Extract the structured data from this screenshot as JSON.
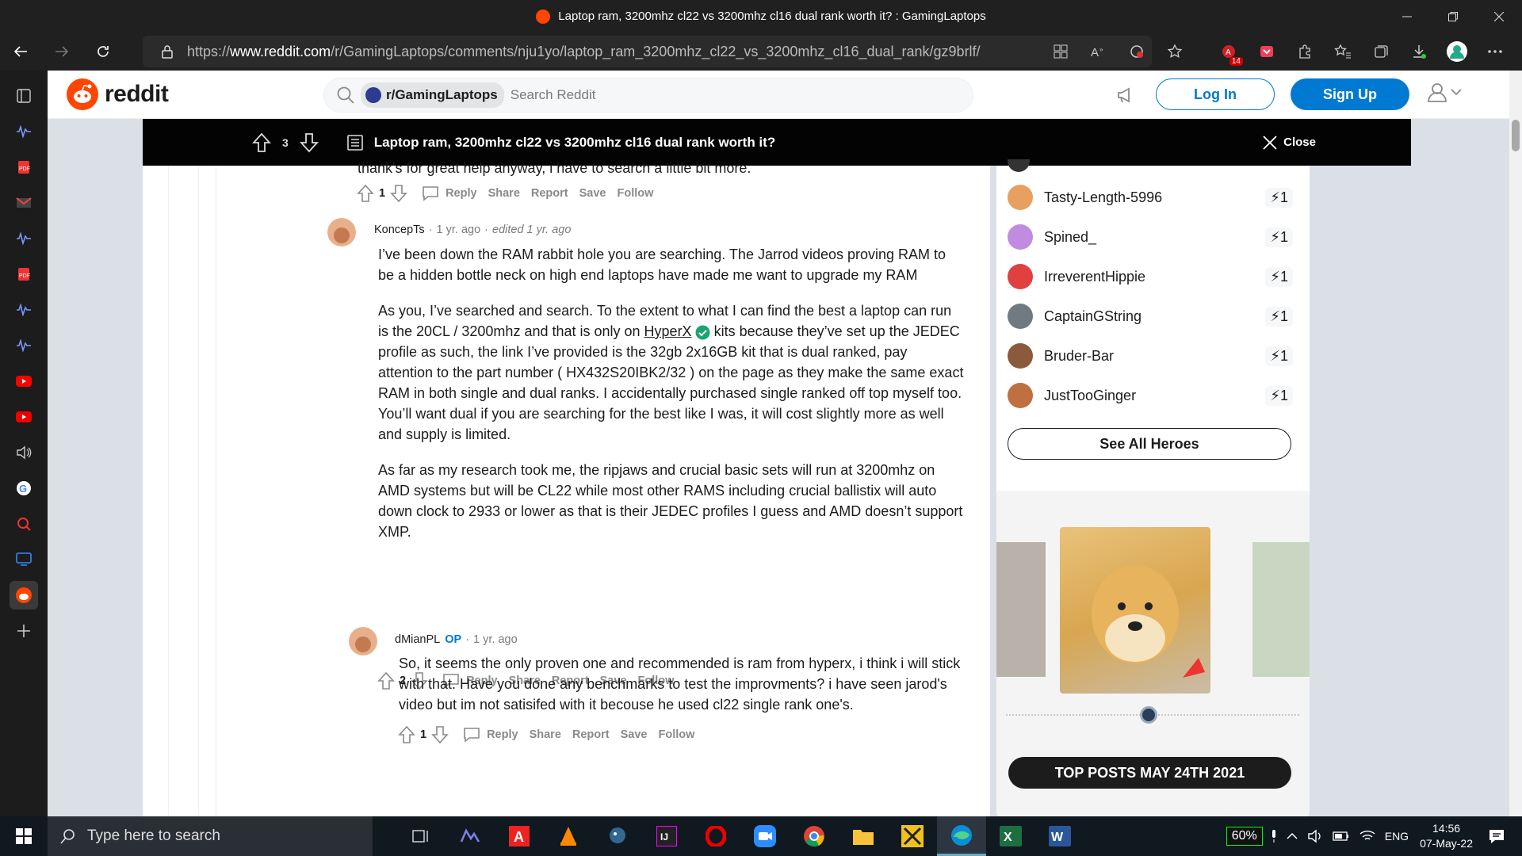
{
  "window": {
    "title": "Laptop ram, 3200mhz cl22 vs 3200mhz cl16 dual rank worth it? : GamingLaptops"
  },
  "browser": {
    "url_prefix": "https://",
    "url_host": "www.reddit.com",
    "url_path": "/r/GamingLaptops/comments/nju1yo/laptop_ram_3200mhz_cl22_vs_3200mhz_cl16_dual_rank/gz9brlf/",
    "badge_count": "14"
  },
  "reddit": {
    "logo_text": "reddit",
    "subreddit_chip": "r/GamingLaptops",
    "search_placeholder": "Search Reddit",
    "login_label": "Log In",
    "signup_label": "Sign Up"
  },
  "post": {
    "score": "3",
    "title": "Laptop ram, 3200mhz cl22 vs 3200mhz cl16 dual rank worth it?",
    "close_label": "Close"
  },
  "comments": [
    {
      "text_tail": "thank's for great help anyway, i have to search a little bit more.",
      "score": "1"
    },
    {
      "author": "KoncepTs",
      "time": "1 yr. ago",
      "edited": "edited 1 yr. ago",
      "p1": "I’ve been down the RAM rabbit hole you are searching. The Jarrod videos proving RAM to be a hidden bottle neck on high end laptops have made me want to upgrade my RAM",
      "p2a": "As you, I’ve searched and search. To the extent to what I can find the best a laptop can run is the 20CL / 3200mhz and that is only on ",
      "p2link": "HyperX",
      "p2b": " kits because they’ve set up the JEDEC profile as such, the link I’ve provided is the 32gb 2x16GB kit that is dual ranked, pay attention to the part number ( HX432S20IBK2/32 ) on the page as they make the same exact RAM in both single and dual ranks. I accidentally purchased single ranked off top myself too. You’ll want dual if you are searching for the best like I was, it will cost slightly more as well and supply is limited.",
      "p3": "As far as my research took me, the ripjaws and crucial basic sets will run at 3200mhz on AMD systems but will be CL22 while most other RAMS including crucial ballistix will auto down clock to 2933 or lower as that is their JEDEC profiles I guess and AMD doesn’t support XMP.",
      "score": "2"
    },
    {
      "author": "dMianPL",
      "op": "OP",
      "time": "1 yr. ago",
      "p1": "So, it seems the only proven one and recommended is ram from hyperx, i think i will stick with that. Have you done any benchmarks to test the improvments? i have seen jarod's video but im not satisifed with it becouse he used cl22 single rank one's.",
      "score": "1"
    }
  ],
  "actions": {
    "reply": "Reply",
    "share": "Share",
    "report": "Report",
    "save": "Save",
    "follow": "Follow"
  },
  "heroes": [
    {
      "name": "Tasty-Length-5996",
      "count": "1",
      "color": "#e8a060"
    },
    {
      "name": "Spined_",
      "count": "1",
      "color": "#c08be0"
    },
    {
      "name": "IrreverentHippie",
      "count": "1",
      "color": "#e04040"
    },
    {
      "name": "CaptainGString",
      "count": "1",
      "color": "#707a80"
    },
    {
      "name": "Bruder-Bar",
      "count": "1",
      "color": "#8b5a3c"
    },
    {
      "name": "JustTooGinger",
      "count": "1",
      "color": "#c07040"
    }
  ],
  "see_all_label": "See All Heroes",
  "top_posts_label": "TOP POSTS MAY 24TH 2021",
  "taskbar": {
    "search_placeholder": "Type here to search",
    "battery": "60%",
    "lang": "ENG",
    "time": "14:56",
    "date": "07-May-22"
  },
  "colors": {
    "reddit_orange": "#ff4500",
    "reddit_blue": "#0079d3"
  }
}
